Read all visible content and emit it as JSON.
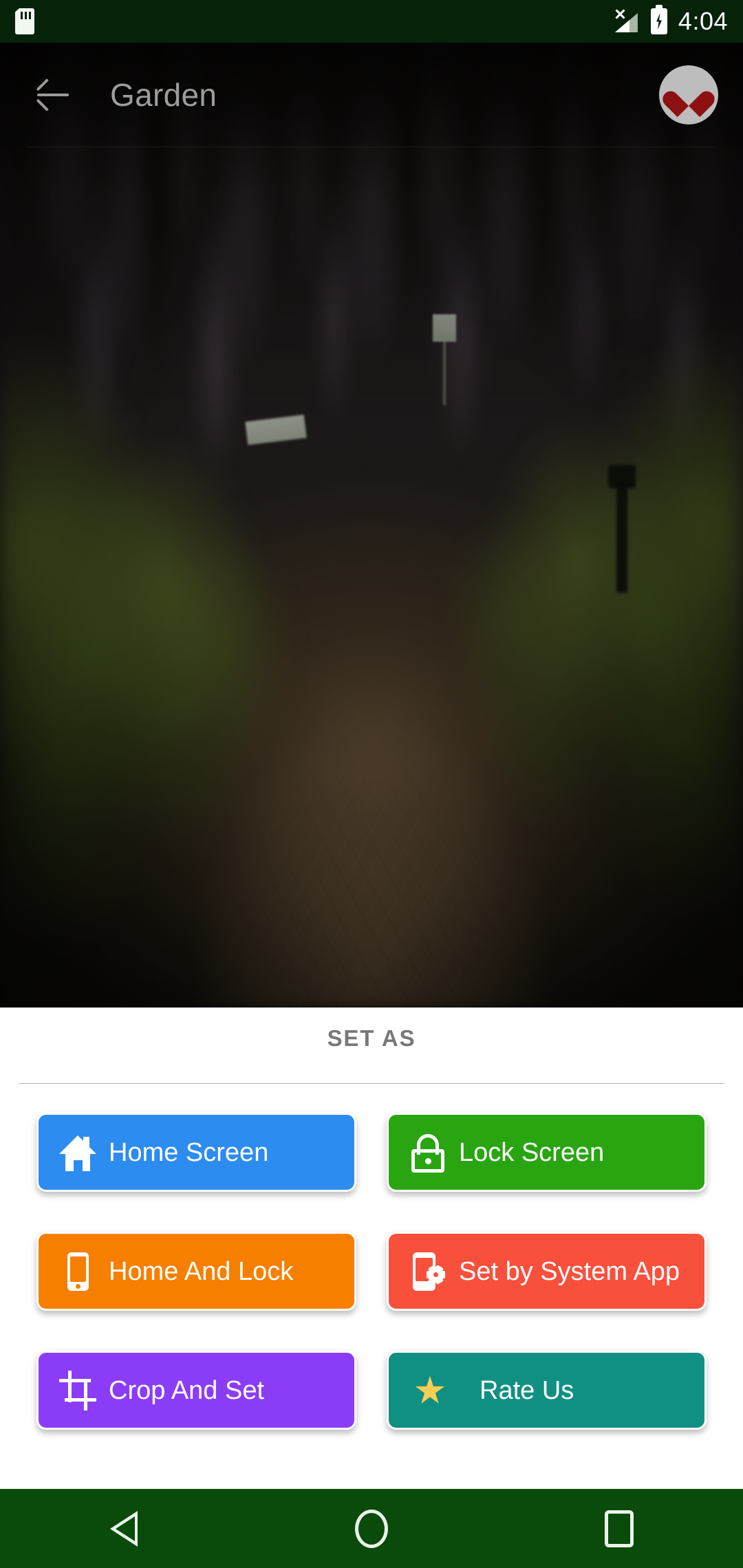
{
  "status_bar": {
    "time": "4:04",
    "icons": {
      "storage": "sd-card-icon",
      "signal": "signal-no-service-icon",
      "battery": "battery-charging-icon"
    }
  },
  "app_bar": {
    "back_label": "back-arrow-icon",
    "title": "Garden",
    "favorite_label": "heart-icon",
    "favorite_active": true,
    "favorite_color": "#8d1111",
    "favorite_bg": "#bdbdbd",
    "title_color": "#9d9d9d"
  },
  "wallpaper": {
    "description": "Garden path under a wisteria tunnel",
    "dominant_colors": [
      "#1b1520",
      "#5d7a2a",
      "#a08058",
      "#b0a0c0"
    ]
  },
  "panel": {
    "title": "SET AS",
    "title_color": "#787878",
    "divider_color": "#b5b5b5",
    "buttons": [
      {
        "label": "Home Screen",
        "icon": "home-icon",
        "color": "#2d8cf0"
      },
      {
        "label": "Lock Screen",
        "icon": "lock-icon",
        "color": "#2aa512"
      },
      {
        "label": "Home And Lock",
        "icon": "smartphone-icon",
        "color": "#f77f00"
      },
      {
        "label": "Set by System App",
        "icon": "phone-settings-icon",
        "color": "#f9503c"
      },
      {
        "label": "Crop And Set",
        "icon": "crop-icon",
        "color": "#8b3cf7"
      },
      {
        "label": "Rate Us",
        "icon": "star-icon",
        "color": "#109083"
      }
    ]
  },
  "nav_bar": {
    "background": "#0a4a0a",
    "items": [
      {
        "name": "back",
        "icon": "triangle-back-icon"
      },
      {
        "name": "home",
        "icon": "circle-home-icon"
      },
      {
        "name": "recents",
        "icon": "square-recents-icon"
      }
    ]
  }
}
